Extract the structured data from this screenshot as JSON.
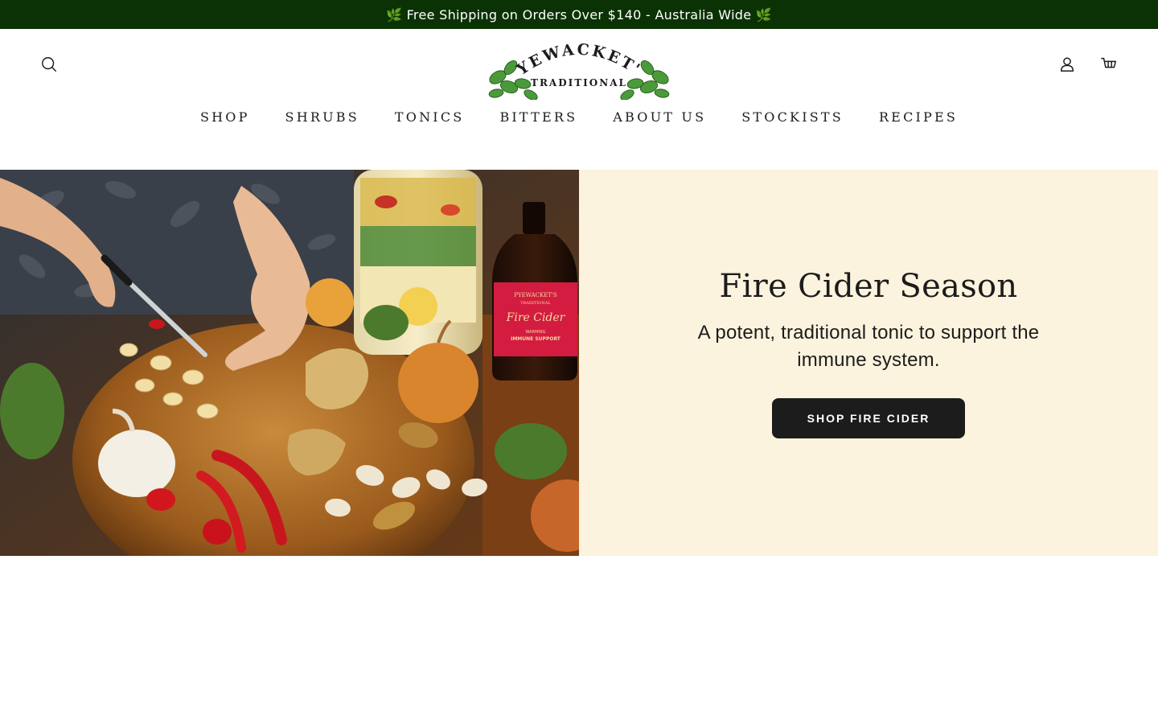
{
  "announcement": {
    "text": "🌿 Free Shipping on Orders Over $140 - Australia Wide 🌿"
  },
  "header": {
    "logo": {
      "top_text": "PYEWACKET'S",
      "bottom_text": "TRADITIONAL"
    },
    "icons": {
      "search": "search-icon",
      "account": "account-icon",
      "cart": "cart-icon"
    }
  },
  "nav": {
    "items": [
      {
        "label": "SHOP"
      },
      {
        "label": "SHRUBS"
      },
      {
        "label": "TONICS"
      },
      {
        "label": "BITTERS"
      },
      {
        "label": "ABOUT US"
      },
      {
        "label": "STOCKISTS"
      },
      {
        "label": "RECIPES"
      }
    ]
  },
  "hero": {
    "title": "Fire Cider Season",
    "subtitle": "A potent, traditional tonic to support the immune system.",
    "cta_label": "SHOP FIRE CIDER",
    "bottle_label": {
      "brand": "PYEWACKET'S",
      "sub": "TRADITIONAL",
      "product": "Fire Cider",
      "line1": "WARMING",
      "line2": "IMMUNE SUPPORT"
    }
  },
  "colors": {
    "announcement_bg": "#0b3204",
    "hero_panel_bg": "#fbf3dd",
    "button_bg": "#1c1c1c",
    "logo_leaf": "#4a9a3a"
  }
}
